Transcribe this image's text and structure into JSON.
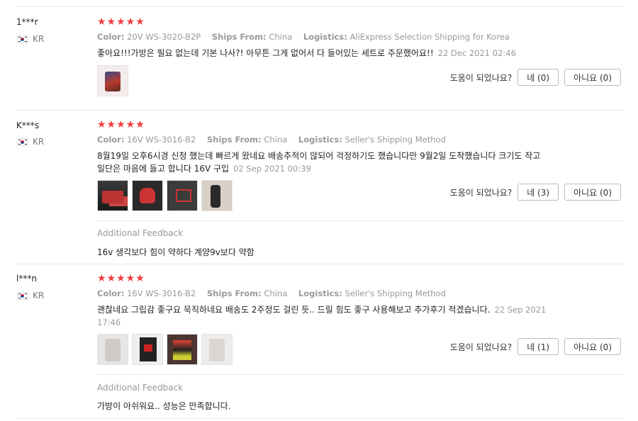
{
  "helpful_label": "도움이 되었나요?",
  "reviews": [
    {
      "user": "1***r",
      "country": "KR",
      "stars": "★★★★★",
      "color_label": "Color:",
      "color": "20V WS-3020-B2P",
      "ships_label": "Ships From:",
      "ships": "China",
      "logistics_label": "Logistics:",
      "logistics": "AliExpress Selection Shipping for Korea",
      "text": "좋아요!!!가방은 필요 없는데 기본 나사?! 아무튼 그게 없어서 다 들어있는 세트로 주문했어요!!",
      "date": "22 Dec 2021 02:46",
      "yes_btn": "네 (0)",
      "no_btn": "아니요 (0)"
    },
    {
      "user": "K***s",
      "country": "KR",
      "stars": "★★★★★",
      "color_label": "Color:",
      "color": "16V WS-3016-B2",
      "ships_label": "Ships From:",
      "ships": "China",
      "logistics_label": "Logistics:",
      "logistics": "Seller's Shipping Method",
      "text_line1": "8월19일 오후6시경 신청 했는데 빠르게 왔네요 배송추적이 않되어 걱정하기도 했습니다만 9월2일 도착했습니다 크기도 작고",
      "text_line2": "일단은 마음에 들고 합니다 16V 구입",
      "date": "02 Sep 2021 00:39",
      "yes_btn": "네 (3)",
      "no_btn": "아니요 (0)",
      "addl_title": "Additional Feedback",
      "addl_text": "16v 생각보다 힘이 약하다 계양9v보다 약함"
    },
    {
      "user": "l***n",
      "country": "KR",
      "stars": "★★★★★",
      "color_label": "Color:",
      "color": "16V WS-3016-B2",
      "ships_label": "Ships From:",
      "ships": "China",
      "logistics_label": "Logistics:",
      "logistics": "Seller's Shipping Method",
      "text": "괜찮네요 그립감 좋구요 묵직하네요 배송도 2주정도 걸린 듯.. 드릴 힘도 좋구 사용해보고 추가후기 적겠습니다.",
      "date_part1": "22 Sep 2021",
      "date_part2": "17:46",
      "yes_btn": "네 (1)",
      "no_btn": "아니요 (0)",
      "addl_title": "Additional Feedback",
      "addl_text": "가방이 아쉬워요.. 성능은 만족합니다."
    }
  ]
}
